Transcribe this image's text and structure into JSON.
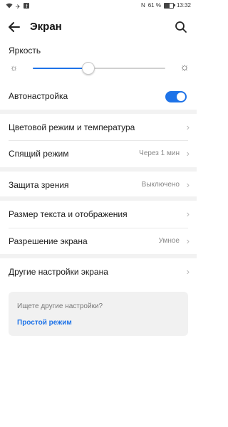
{
  "status_bar": {
    "left_icons": [
      "wifi-icon",
      "airplane-icon",
      "facebook-icon"
    ],
    "nfc": "N",
    "battery_percent": "61 %",
    "battery_level": 0.61,
    "time": "13:32"
  },
  "app_bar": {
    "title": "Экран"
  },
  "brightness": {
    "label": "Яркость",
    "level": 0.42
  },
  "auto_brightness": {
    "label": "Автонастройка",
    "enabled": true
  },
  "settings": [
    {
      "label": "Цветовой режим и температура",
      "value": ""
    },
    {
      "label": "Спящий режим",
      "value": "Через 1 мин"
    },
    {
      "label": "Защита зрения",
      "value": "Выключено"
    },
    {
      "label": "Размер текста и отображения",
      "value": ""
    },
    {
      "label": "Разрешение экрана",
      "value": "Умное"
    },
    {
      "label": "Другие настройки экрана",
      "value": ""
    }
  ],
  "hint_card": {
    "question": "Ищете другие настройки?",
    "link": "Простой режим"
  },
  "colors": {
    "accent": "#1e73e8",
    "section_gap": "#f2f2f2"
  }
}
